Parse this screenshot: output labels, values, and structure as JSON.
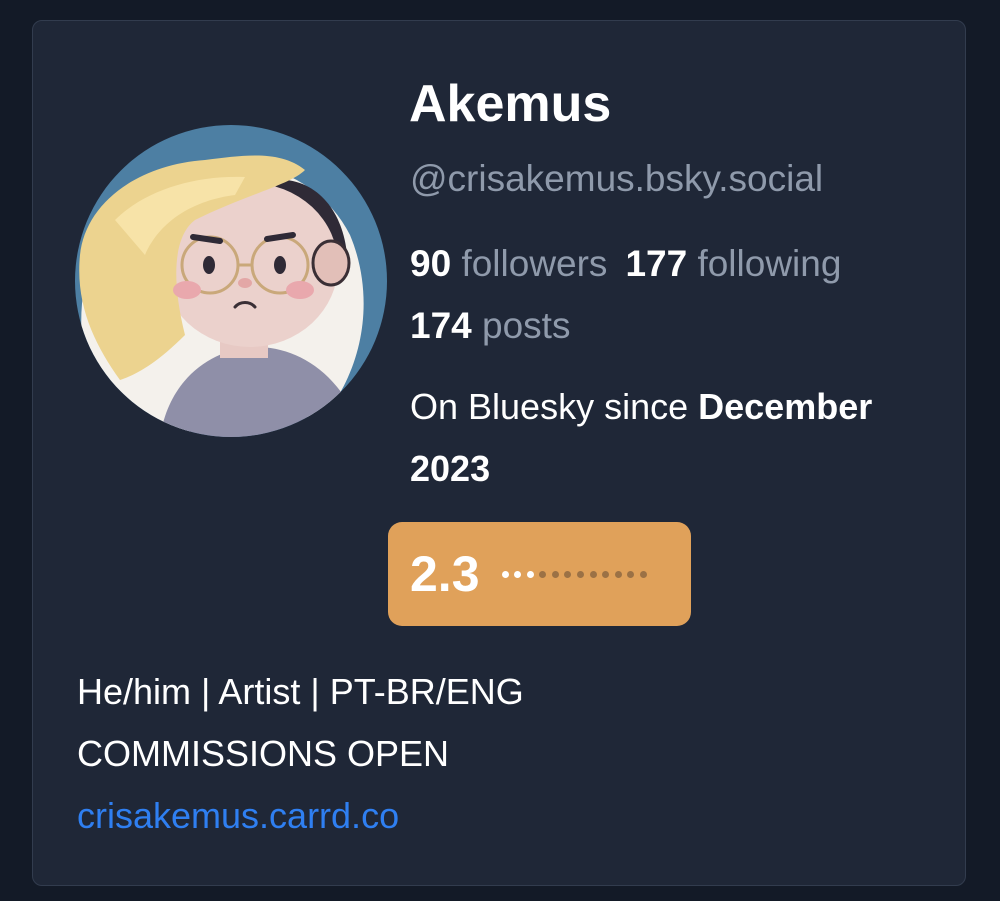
{
  "profile": {
    "display_name": "Akemus",
    "handle": "@crisakemus.bsky.social",
    "avatar_icon": "cartoon-portrait-avatar"
  },
  "stats": {
    "followers_count": "90",
    "followers_label": "followers",
    "following_count": "177",
    "following_label": "following",
    "posts_count": "174",
    "posts_label": "posts"
  },
  "joined": {
    "prefix": "On Bluesky since",
    "date": "December 2023"
  },
  "score": {
    "value": "2.3",
    "level_fraction": 0.23,
    "badge_color": "#e0a15a"
  },
  "bio": {
    "line1": "He/him | Artist | PT-BR/ENG",
    "line2": "COMMISSIONS OPEN",
    "link": "crisakemus.carrd.co",
    "link_color": "#2f7ff1"
  }
}
